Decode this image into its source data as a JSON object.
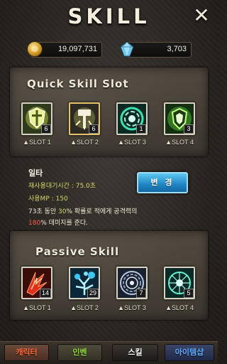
{
  "header": {
    "title": "SKILL",
    "close_glyph": "✕"
  },
  "currency": {
    "gold": {
      "icon": "gold-coin-icon",
      "value": "19,097,731"
    },
    "gem": {
      "icon": "gem-icon",
      "value": "3,703"
    }
  },
  "quick_slot": {
    "title": "Quick Skill Slot",
    "slots": [
      {
        "label": "▲SLOT 1",
        "count": "6",
        "icon": "shield-sword-icon",
        "selected": false
      },
      {
        "label": "▲SLOT 2",
        "count": "6",
        "icon": "hammer-strike-icon",
        "selected": true
      },
      {
        "label": "▲SLOT 3",
        "count": "1",
        "icon": "green-vortex-icon",
        "selected": false
      },
      {
        "label": "▲SLOT 4",
        "count": "3",
        "icon": "nature-shield-icon",
        "selected": false
      }
    ]
  },
  "skill_info": {
    "name": "일타",
    "cooldown": "재사용대기시간 : 75.0초",
    "mp": "사용MP : 150",
    "desc1_pre": "73초 동안 ",
    "desc1_hl": "30",
    "desc1_post": "% 확률로 적에게 공격력의",
    "desc2_hl": "180",
    "desc2_post": "% 데미지를 준다.",
    "change_button": "변 경"
  },
  "passive": {
    "title": "Passive Skill",
    "slots": [
      {
        "label": "▲SLOT 1",
        "count": "14",
        "icon": "fire-slash-icon"
      },
      {
        "label": "▲SLOT 2",
        "count": "29",
        "icon": "frost-tree-icon"
      },
      {
        "label": "▲SLOT 3",
        "count": "7",
        "icon": "spiral-ring-icon"
      },
      {
        "label": "▲SLOT 4",
        "count": "5",
        "icon": "magic-circle-icon"
      }
    ]
  },
  "tabs": [
    {
      "label": "캐릭터",
      "color": "#ff6a38"
    },
    {
      "label": "인벤",
      "color": "#8edc3a"
    },
    {
      "label": "스킬",
      "color": "#ffffff"
    },
    {
      "label": "아이템샵",
      "color": "#5fa8ff"
    }
  ]
}
